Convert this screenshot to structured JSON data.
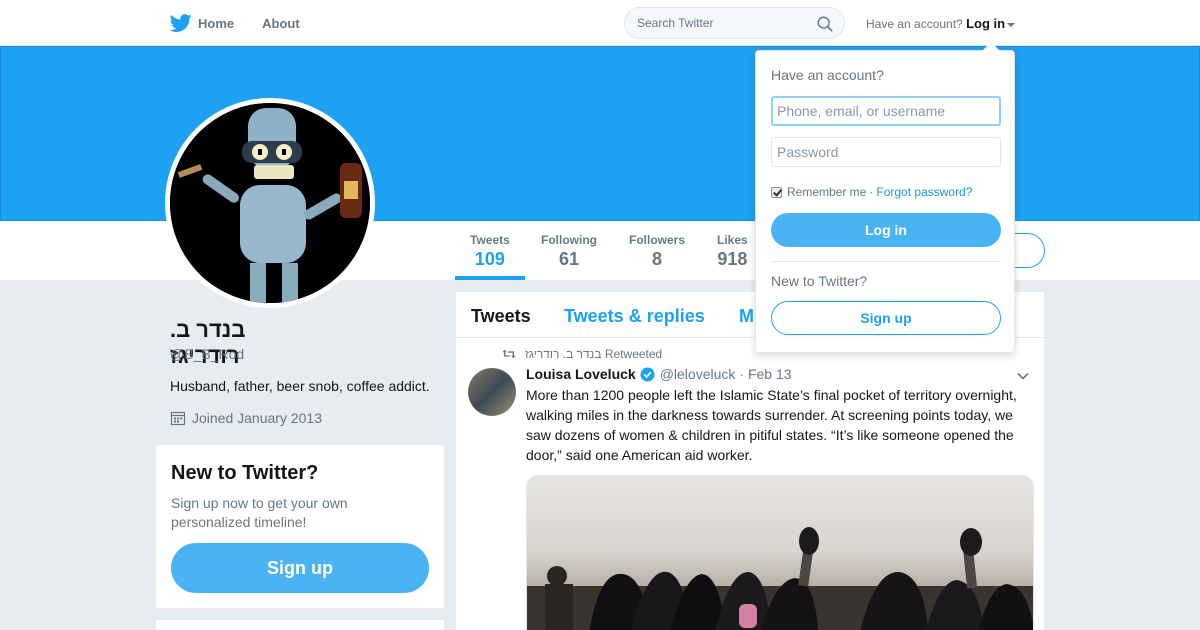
{
  "nav": {
    "home": "Home",
    "about": "About",
    "search_placeholder": "Search Twitter",
    "have_account": "Have an account?",
    "login": "Log in"
  },
  "profile": {
    "name": "בנדר ב. רודריגז",
    "handle": "@B_B_Rod",
    "bio": "Husband, father, beer snob, coffee addict.",
    "joined": "Joined January 2013"
  },
  "stats": [
    {
      "label": "Tweets",
      "value": "109"
    },
    {
      "label": "Following",
      "value": "61"
    },
    {
      "label": "Followers",
      "value": "8"
    },
    {
      "label": "Likes",
      "value": "918"
    }
  ],
  "signup_card": {
    "title": "New to Twitter?",
    "text": "Sign up now to get your own personalized timeline!",
    "button": "Sign up"
  },
  "timeline": {
    "tabs": [
      "Tweets",
      "Tweets & replies",
      "M"
    ],
    "tweet": {
      "retweeted_by": "בנדר ב. רודריגז Retweeted",
      "author": "Louisa Loveluck",
      "handle": "@leloveluck",
      "date": "· Feb 13",
      "text": "More than 1200 people left the Islamic State’s final pocket of territory overnight, walking miles in the darkness towards surrender. At screening points today, we saw dozens of women & children in pitiful states. “It’s like someone opened the door,” said one American aid worker."
    }
  },
  "login_dropdown": {
    "title": "Have an account?",
    "username_placeholder": "Phone, email, or username",
    "password_placeholder": "Password",
    "remember": "Remember me",
    "separator": "·",
    "forgot": "Forgot password?",
    "login_button": "Log in",
    "new_to_twitter": "New to Twitter?",
    "signup_button": "Sign up"
  },
  "colors": {
    "brand": "#1da1f2",
    "button": "#4ab3f4",
    "background": "#e6ecf0"
  }
}
